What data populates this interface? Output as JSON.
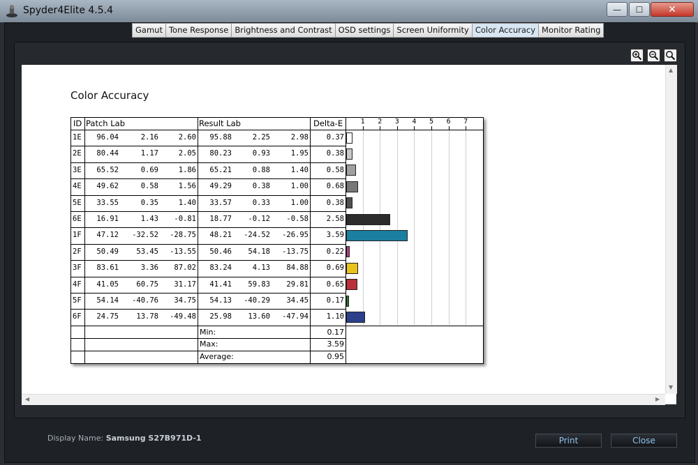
{
  "window": {
    "title": "Spyder4Elite 4.5.4",
    "min_glyph": "—",
    "max_glyph": "☐",
    "close_glyph": "✕"
  },
  "tabs": [
    {
      "label": "Gamut",
      "active": false
    },
    {
      "label": "Tone Response",
      "active": false
    },
    {
      "label": "Brightness and Contrast",
      "active": false
    },
    {
      "label": "OSD settings",
      "active": false
    },
    {
      "label": "Screen Uniformity",
      "active": false
    },
    {
      "label": "Color Accuracy",
      "active": true
    },
    {
      "label": "Monitor Rating",
      "active": false
    }
  ],
  "toolbar": {
    "zoom_in_icon": "zoom-in-icon",
    "zoom_out_icon": "zoom-out-icon",
    "zoom_fit_icon": "zoom-fit-icon"
  },
  "report": {
    "title": "Color Accuracy",
    "headers": {
      "id": "ID",
      "patch": "Patch Lab",
      "result": "Result Lab",
      "delta": "Delta-E"
    },
    "scale_ticks": [
      "1",
      "2",
      "3",
      "4",
      "5",
      "6",
      "7"
    ],
    "rows": [
      {
        "id": "1E",
        "patch": [
          "96.04",
          "2.16",
          "2.60"
        ],
        "result": [
          "95.88",
          "2.25",
          "2.98"
        ],
        "delta": "0.37",
        "color": "#ffffff"
      },
      {
        "id": "2E",
        "patch": [
          "80.44",
          "1.17",
          "2.05"
        ],
        "result": [
          "80.23",
          "0.93",
          "1.95"
        ],
        "delta": "0.38",
        "color": "#c8c8c8"
      },
      {
        "id": "3E",
        "patch": [
          "65.52",
          "0.69",
          "1.86"
        ],
        "result": [
          "65.21",
          "0.88",
          "1.40"
        ],
        "delta": "0.58",
        "color": "#a0a0a0"
      },
      {
        "id": "4E",
        "patch": [
          "49.62",
          "0.58",
          "1.56"
        ],
        "result": [
          "49.29",
          "0.38",
          "1.00"
        ],
        "delta": "0.68",
        "color": "#777777"
      },
      {
        "id": "5E",
        "patch": [
          "33.55",
          "0.35",
          "1.40"
        ],
        "result": [
          "33.57",
          "0.33",
          "1.00"
        ],
        "delta": "0.38",
        "color": "#4f4f4f"
      },
      {
        "id": "6E",
        "patch": [
          "16.91",
          "1.43",
          "-0.81"
        ],
        "result": [
          "18.77",
          "-0.12",
          "-0.58"
        ],
        "delta": "2.58",
        "color": "#2c2c2c"
      },
      {
        "id": "1F",
        "patch": [
          "47.12",
          "-32.52",
          "-28.75"
        ],
        "result": [
          "48.21",
          "-24.52",
          "-26.95"
        ],
        "delta": "3.59",
        "color": "#1a7fa0"
      },
      {
        "id": "2F",
        "patch": [
          "50.49",
          "53.45",
          "-13.55"
        ],
        "result": [
          "50.46",
          "54.18",
          "-13.75"
        ],
        "delta": "0.22",
        "color": "#b0407f"
      },
      {
        "id": "3F",
        "patch": [
          "83.61",
          "3.36",
          "87.02"
        ],
        "result": [
          "83.24",
          "4.13",
          "84.88"
        ],
        "delta": "0.69",
        "color": "#e9c21c"
      },
      {
        "id": "4F",
        "patch": [
          "41.05",
          "60.75",
          "31.17"
        ],
        "result": [
          "41.41",
          "59.83",
          "29.81"
        ],
        "delta": "0.65",
        "color": "#b8303a"
      },
      {
        "id": "5F",
        "patch": [
          "54.14",
          "-40.76",
          "34.75"
        ],
        "result": [
          "54.13",
          "-40.29",
          "34.45"
        ],
        "delta": "0.17",
        "color": "#2f7a2f"
      },
      {
        "id": "6F",
        "patch": [
          "24.75",
          "13.78",
          "-49.48"
        ],
        "result": [
          "25.98",
          "13.60",
          "-47.94"
        ],
        "delta": "1.10",
        "color": "#2b3f8a"
      }
    ],
    "stats": [
      {
        "label": "Min:",
        "value": "0.17"
      },
      {
        "label": "Max:",
        "value": "3.59"
      },
      {
        "label": "Average:",
        "value": "0.95"
      }
    ]
  },
  "footer": {
    "display_label": "Display Name:",
    "display_name": "Samsung S27B971D-1",
    "print_label": "Print",
    "close_label": "Close"
  }
}
